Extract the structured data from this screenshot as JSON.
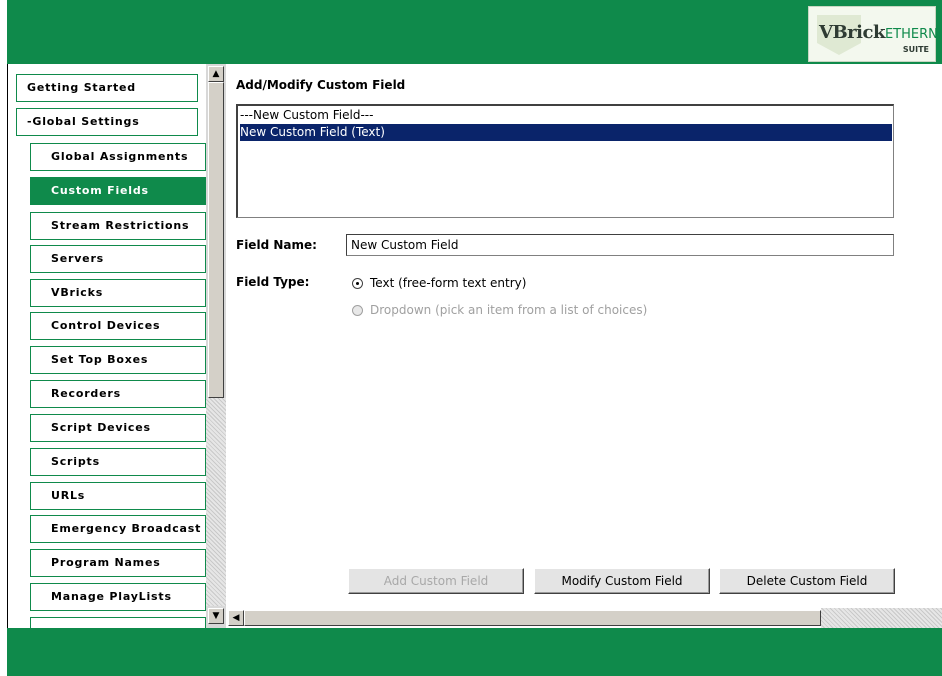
{
  "header": {
    "logo_brand": "VBrick",
    "logo_product": "ETHERNETV",
    "logo_suite": "SUITE",
    "color": "#0f8a4b"
  },
  "sidebar": {
    "items": [
      {
        "label": "Getting Started",
        "level": "top",
        "selected": false
      },
      {
        "label": "-Global Settings",
        "level": "top",
        "selected": false
      },
      {
        "label": "Global Assignments",
        "level": "sub",
        "selected": false
      },
      {
        "label": "Custom Fields",
        "level": "sub",
        "selected": true
      },
      {
        "label": "Stream Restrictions",
        "level": "sub",
        "selected": false
      },
      {
        "label": "Servers",
        "level": "sub",
        "selected": false
      },
      {
        "label": "VBricks",
        "level": "sub",
        "selected": false
      },
      {
        "label": "Control Devices",
        "level": "sub",
        "selected": false
      },
      {
        "label": "Set Top Boxes",
        "level": "sub",
        "selected": false
      },
      {
        "label": "Recorders",
        "level": "sub",
        "selected": false
      },
      {
        "label": "Script Devices",
        "level": "sub",
        "selected": false
      },
      {
        "label": "Scripts",
        "level": "sub",
        "selected": false
      },
      {
        "label": "URLs",
        "level": "sub",
        "selected": false
      },
      {
        "label": "Emergency Broadcast",
        "level": "sub",
        "selected": false
      },
      {
        "label": "Program Names",
        "level": "sub",
        "selected": false
      },
      {
        "label": "Manage PlayLists",
        "level": "sub",
        "selected": false
      }
    ]
  },
  "main": {
    "title": "Add/Modify Custom Field",
    "custom_fields_list": [
      {
        "label": "---New Custom Field---",
        "selected": false
      },
      {
        "label": "New Custom Field (Text)",
        "selected": true
      }
    ],
    "field_name_label": "Field Name:",
    "field_name_value": "New Custom Field",
    "field_type_label": "Field Type:",
    "field_type_options": [
      {
        "label": "Text (free-form text entry)",
        "checked": true,
        "enabled": true
      },
      {
        "label": "Dropdown (pick an item from a list of choices)",
        "checked": false,
        "enabled": false
      }
    ],
    "buttons": {
      "add": {
        "label": "Add Custom Field",
        "enabled": false
      },
      "modify": {
        "label": "Modify Custom Field",
        "enabled": true
      },
      "delete": {
        "label": "Delete Custom Field",
        "enabled": true
      }
    }
  }
}
